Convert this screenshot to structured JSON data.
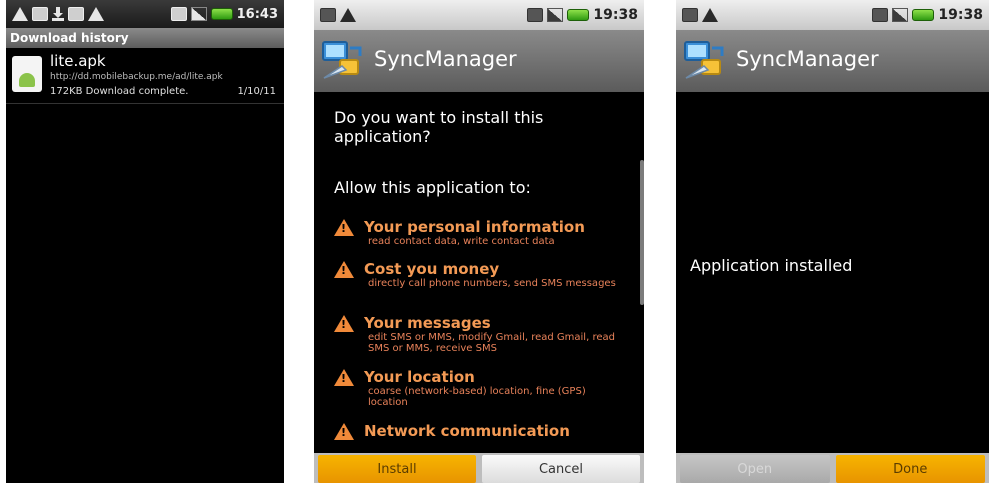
{
  "screens": {
    "download_history": {
      "status_time": "16:43",
      "title": "Download history",
      "item": {
        "name": "lite.apk",
        "url": "http://dd.mobilebackup.me/ad/lite.apk",
        "status": "172KB Download complete.",
        "date": "1/10/11"
      }
    },
    "install_prompt": {
      "status_time": "19:38",
      "app_name": "SyncManager",
      "question": "Do you want to install this application?",
      "allow_heading": "Allow this application to:",
      "permissions": [
        {
          "title": "Your personal information",
          "desc": "read contact data, write contact data"
        },
        {
          "title": "Cost you money",
          "desc": "directly call phone numbers, send SMS messages"
        },
        {
          "title": "Your messages",
          "desc": "edit SMS or MMS, modify Gmail, read Gmail, read SMS or MMS, receive SMS"
        },
        {
          "title": "Your location",
          "desc": "coarse (network-based) location, fine (GPS) location"
        },
        {
          "title": "Network communication",
          "desc": ""
        }
      ],
      "buttons": {
        "install": "Install",
        "cancel": "Cancel"
      }
    },
    "installed": {
      "status_time": "19:38",
      "app_name": "SyncManager",
      "message": "Application installed",
      "buttons": {
        "open": "Open",
        "done": "Done"
      }
    }
  },
  "colors": {
    "accent_button": "#f7b400",
    "permission_text": "#f39a55",
    "permission_desc": "#e8825a"
  },
  "icons": [
    "warning-icon",
    "download-icon",
    "sim-icon",
    "signal-icon",
    "battery-icon",
    "apk-icon",
    "sync-app-icon"
  ]
}
